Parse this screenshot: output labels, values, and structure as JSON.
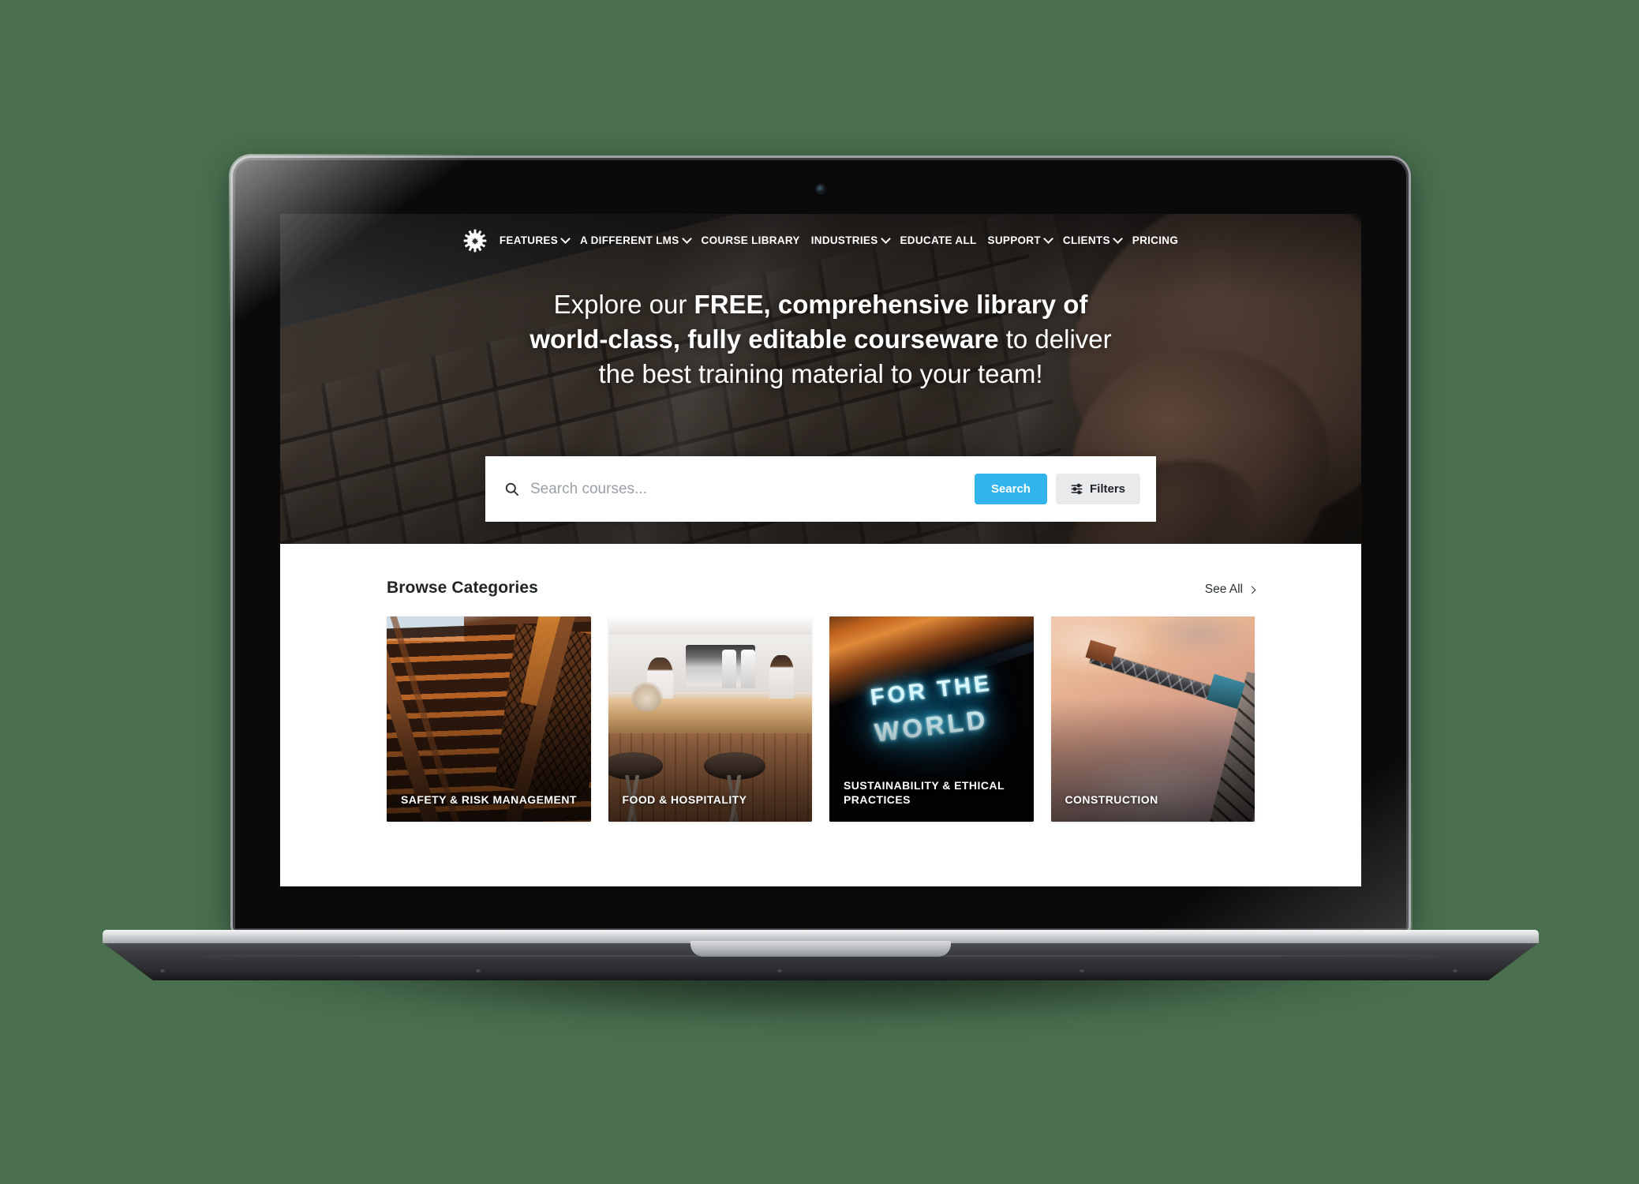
{
  "page": {
    "background_color": "#4a7050",
    "device": "laptop-mockup"
  },
  "site": {
    "logo_icon": "gear-icon"
  },
  "nav": {
    "items": [
      {
        "label": "FEATURES",
        "has_dropdown": true
      },
      {
        "label": "A DIFFERENT LMS",
        "has_dropdown": true
      },
      {
        "label": "COURSE LIBRARY",
        "has_dropdown": false
      },
      {
        "label": "INDUSTRIES",
        "has_dropdown": true
      },
      {
        "label": "EDUCATE ALL",
        "has_dropdown": false
      },
      {
        "label": "SUPPORT",
        "has_dropdown": true
      },
      {
        "label": "CLIENTS",
        "has_dropdown": true
      },
      {
        "label": "PRICING",
        "has_dropdown": false
      }
    ]
  },
  "hero": {
    "headline_parts": [
      {
        "text": "Explore our ",
        "bold": false
      },
      {
        "text": "FREE, comprehensive library of world-class, fully editable courseware",
        "bold": true
      },
      {
        "text": " to deliver the best training material to your team!",
        "bold": false
      }
    ],
    "background_image": "hands-typing-on-laptop-keyboard"
  },
  "search": {
    "icon": "search-icon",
    "placeholder": "Search courses...",
    "value": "",
    "search_button_label": "Search",
    "search_button_color": "#32b4ed",
    "filters_button_label": "Filters",
    "filters_icon": "sliders-icon",
    "filters_button_color": "#e9eaec"
  },
  "categories_section": {
    "title": "Browse Categories",
    "see_all_label": "See All",
    "see_all_icon": "chevron-right-icon",
    "cards": [
      {
        "label": "SAFETY & RISK MANAGEMENT",
        "image": "rusty-industrial-staircase"
      },
      {
        "label": "FOOD & HOSPITALITY",
        "image": "cafe-counter-with-stools"
      },
      {
        "label": "SUSTAINABILITY & ETHICAL PRACTICES",
        "image": "neon-sign-for-the-world"
      },
      {
        "label": "CONSTRUCTION",
        "image": "tower-crane-at-sunset"
      }
    ]
  },
  "neon_art": {
    "line1": "FOR THE",
    "line2": "WORLD"
  }
}
